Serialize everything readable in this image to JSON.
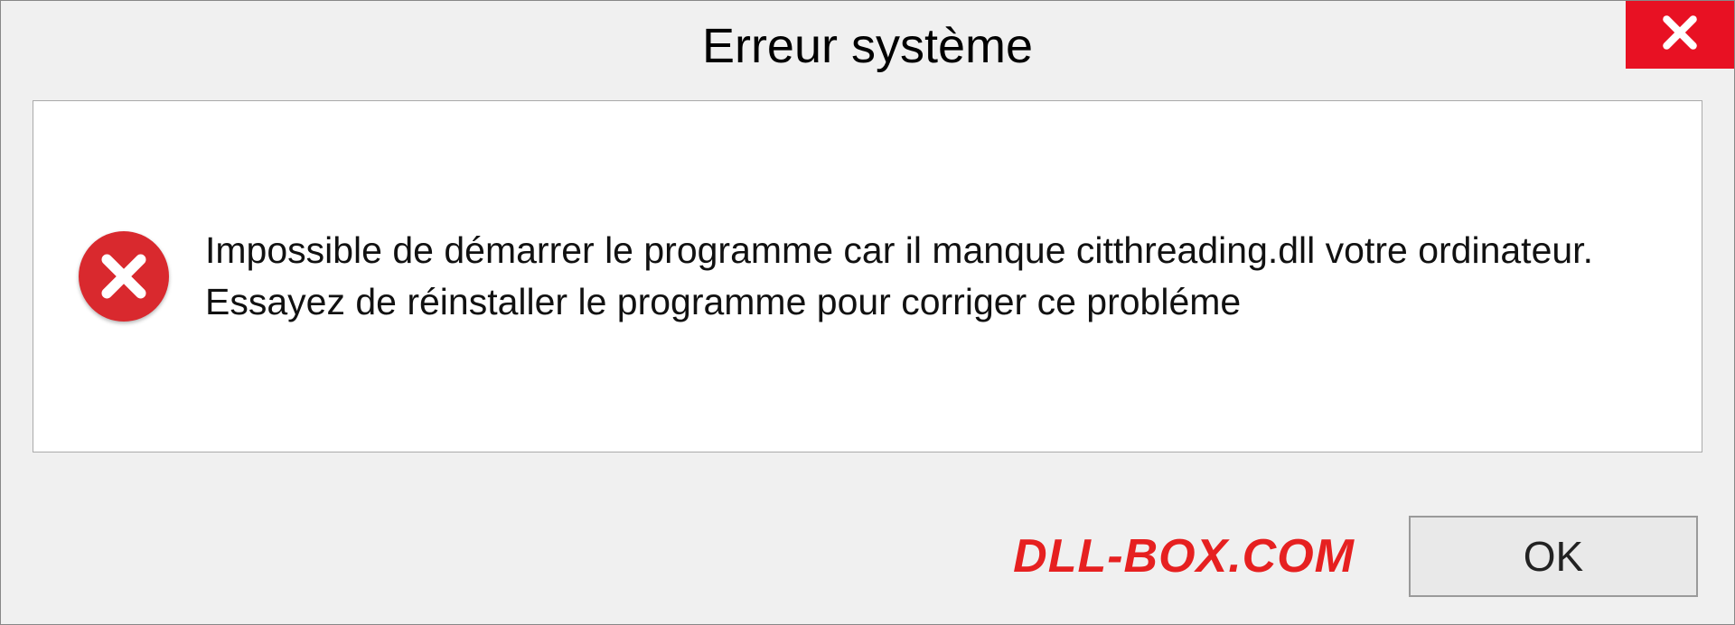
{
  "dialog": {
    "title": "Erreur système",
    "message": "Impossible de démarrer le programme car il manque citthreading.dll votre ordinateur. Essayez de réinstaller le programme pour corriger ce probléme",
    "ok_label": "OK",
    "brand": "DLL-BOX.COM"
  }
}
